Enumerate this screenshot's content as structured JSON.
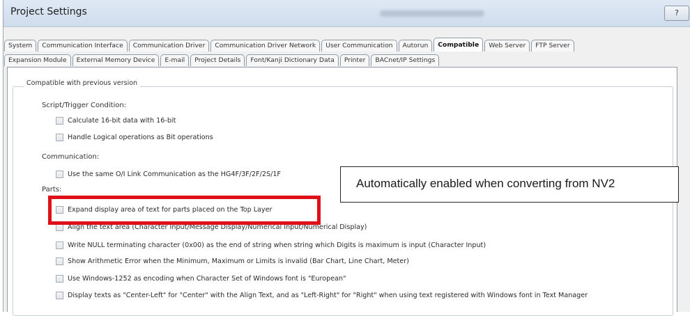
{
  "window": {
    "title": "Project Settings",
    "help_label": "?"
  },
  "tabs_row1": [
    {
      "label": "System",
      "active": false
    },
    {
      "label": "Communication Interface",
      "active": false
    },
    {
      "label": "Communication Driver",
      "active": false
    },
    {
      "label": "Communication Driver Network",
      "active": false
    },
    {
      "label": "User Communication",
      "active": false
    },
    {
      "label": "Autorun",
      "active": false
    },
    {
      "label": "Compatible",
      "active": true
    },
    {
      "label": "Web Server",
      "active": false
    },
    {
      "label": "FTP Server",
      "active": false
    }
  ],
  "tabs_row2": [
    {
      "label": "Expansion Module",
      "active": false
    },
    {
      "label": "External Memory Device",
      "active": false
    },
    {
      "label": "E-mail",
      "active": false
    },
    {
      "label": "Project Details",
      "active": false
    },
    {
      "label": "Font/Kanji Dictionary Data",
      "active": false
    },
    {
      "label": "Printer",
      "active": false
    },
    {
      "label": "BACnet/IP Settings",
      "active": false
    }
  ],
  "group": {
    "title": "Compatible with previous version",
    "script_section": "Script/Trigger Condition:",
    "script_options": [
      "Calculate 16-bit data with 16-bit",
      "Handle Logical operations as Bit operations"
    ],
    "comm_section": "Communication:",
    "comm_options": [
      "Use the same O/I Link Communication as the HG4F/3F/2F/2S/1F"
    ],
    "parts_section": "Parts:",
    "parts_options": [
      "Expand display area of text for parts placed on the Top Layer",
      "Align the text area (Character Input/Message Display/Numerical Input/Numerical Display)",
      "Write NULL terminating character (0x00) as the end of string when string which Digits is maximum is input (Character Input)",
      "Show Arithmetic Error when the Minimum, Maximum or Limits is invalid (Bar Chart, Line Chart, Meter)",
      "Use Windows-1252 as encoding when Character Set of Windows font is \"European\"",
      "Display texts as \"Center-Left\" for \"Center\" with the Align Text, and as \"Left-Right\" for \"Right\" when using text registered with Windows font in Text Manager"
    ]
  },
  "callout": {
    "text": "Automatically enabled when converting from NV2"
  },
  "colors": {
    "highlight": "#e0101b"
  }
}
